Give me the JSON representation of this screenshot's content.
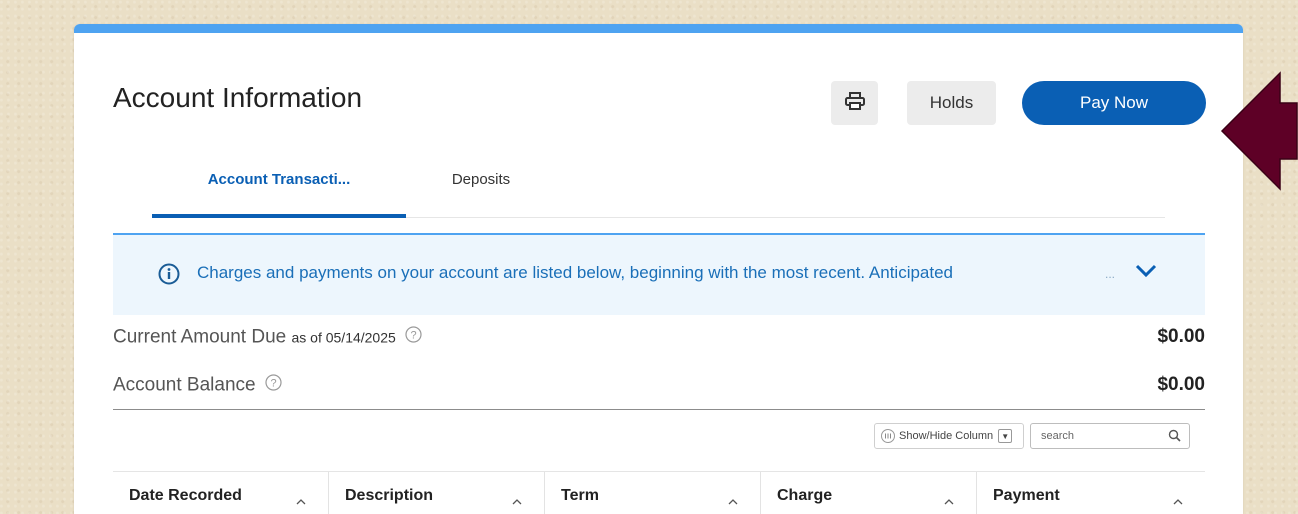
{
  "header": {
    "title": "Account Information",
    "holds_label": "Holds",
    "pay_label": "Pay Now"
  },
  "tabs": [
    {
      "label": "Account Transacti...",
      "active": true
    },
    {
      "label": "Deposits",
      "active": false
    }
  ],
  "info_banner": {
    "text": "Charges and payments on your account are listed below, beginning with the most recent. Anticipated",
    "ellipsis": "..."
  },
  "summary": {
    "current_due": {
      "label": "Current Amount Due",
      "as_of": "as of 05/14/2025",
      "amount": "$0.00"
    },
    "balance": {
      "label": "Account Balance",
      "amount": "$0.00"
    }
  },
  "table_tools": {
    "show_hide_label": "Show/Hide Column",
    "search_placeholder": "search"
  },
  "table": {
    "columns": [
      "Date Recorded",
      "Description",
      "Term",
      "Charge",
      "Payment"
    ]
  },
  "colors": {
    "primary": "#0a5fb4",
    "accent_top": "#4ea3f1",
    "banner_bg": "#edf6fd",
    "arrow": "#5e0026"
  },
  "icons": [
    "print-icon",
    "info-icon",
    "chevron-down-icon",
    "help-icon",
    "columns-icon",
    "search-icon",
    "sort-icon",
    "arrow-left-icon"
  ]
}
